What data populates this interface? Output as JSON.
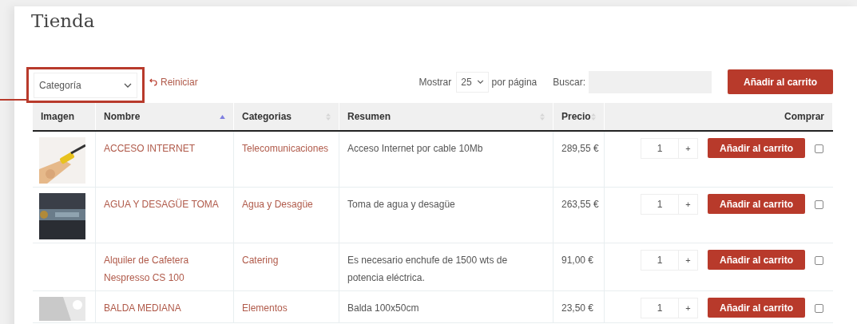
{
  "page": {
    "title": "Tienda"
  },
  "toolbar": {
    "category_select": {
      "value": "Categoría"
    },
    "reset_link": "Reiniciar",
    "show_label": "Mostrar",
    "page_size": "25",
    "per_page_label": "por página",
    "search_label": "Buscar:",
    "add_button": "Añadir al carrito"
  },
  "table": {
    "columns": [
      {
        "label": "Imagen",
        "sortable": false,
        "sorted": false
      },
      {
        "label": "Nombre",
        "sortable": true,
        "sorted": true
      },
      {
        "label": "Categorias",
        "sortable": true,
        "sorted": false
      },
      {
        "label": "Resumen",
        "sortable": true,
        "sorted": false
      },
      {
        "label": "Precio",
        "sortable": true,
        "sorted": false
      },
      {
        "label": "Comprar",
        "sortable": false,
        "sorted": false
      }
    ],
    "rows": [
      {
        "image": {
          "kind": "picture"
        },
        "name": [
          "ACCESO INTERNET"
        ],
        "category": "Telecomunicaciones",
        "summary": [
          "Acceso Internet por cable 10Mb"
        ],
        "price": "289,55 €",
        "quantity": "1",
        "plus": "+",
        "button": "Añadir al carrito",
        "checked": false
      },
      {
        "image": {
          "kind": "picture"
        },
        "name": [
          "AGUA Y DESAGÜE TOMA"
        ],
        "category": "Agua y Desagüe",
        "summary": [
          "Toma de agua y desagüe"
        ],
        "price": "263,55 €",
        "quantity": "1",
        "plus": "+",
        "button": "Añadir al carrito",
        "checked": false
      },
      {
        "name": [
          "Alquiler de Cafetera",
          "Nespresso CS 100"
        ],
        "category": "Catering",
        "summary": [
          "Es necesario enchufe de 1500 wts de",
          "potencia eléctrica."
        ],
        "price": "91,00 €",
        "quantity": "1",
        "plus": "+",
        "button": "Añadir al carrito",
        "checked": false
      },
      {
        "image": {
          "kind": "picture"
        },
        "name": [
          "BALDA MEDIANA"
        ],
        "category": "Elementos",
        "summary": [
          "Balda 100x50cm"
        ],
        "price": "23,50 €",
        "quantity": "1",
        "plus": "+",
        "button": "Añadir al carrito",
        "checked": false
      }
    ]
  }
}
